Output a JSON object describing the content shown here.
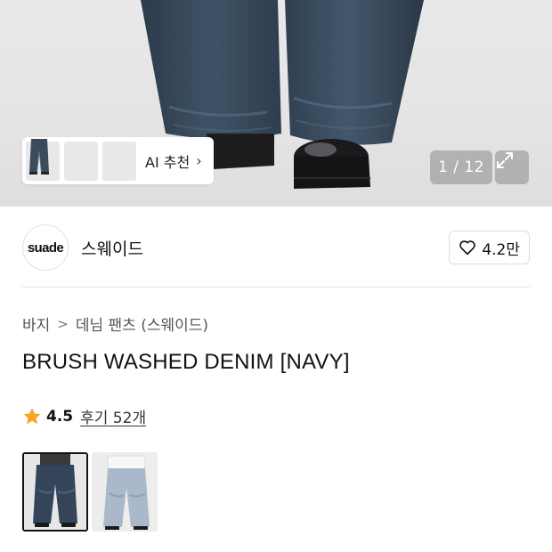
{
  "gallery": {
    "ai_label": "AI 추천",
    "ai_chevron": "›",
    "counter": "1 / 12",
    "expand_icon": "expand-icon"
  },
  "brand": {
    "logo_text": "suade",
    "name": "스웨이드",
    "like_count": "4.2만"
  },
  "breadcrumb": [
    "바지",
    "데님 팬츠 (스웨이드)"
  ],
  "product": {
    "title": "BRUSH WASHED DENIM [NAVY]",
    "rating": "4.5",
    "reviews": "후기 52개"
  },
  "colors": {
    "star": "#f5a623",
    "dark_denim": "#34455a",
    "light_denim": "#a9b9c9",
    "selected_option": 0
  },
  "options": [
    "navy",
    "light-blue"
  ]
}
